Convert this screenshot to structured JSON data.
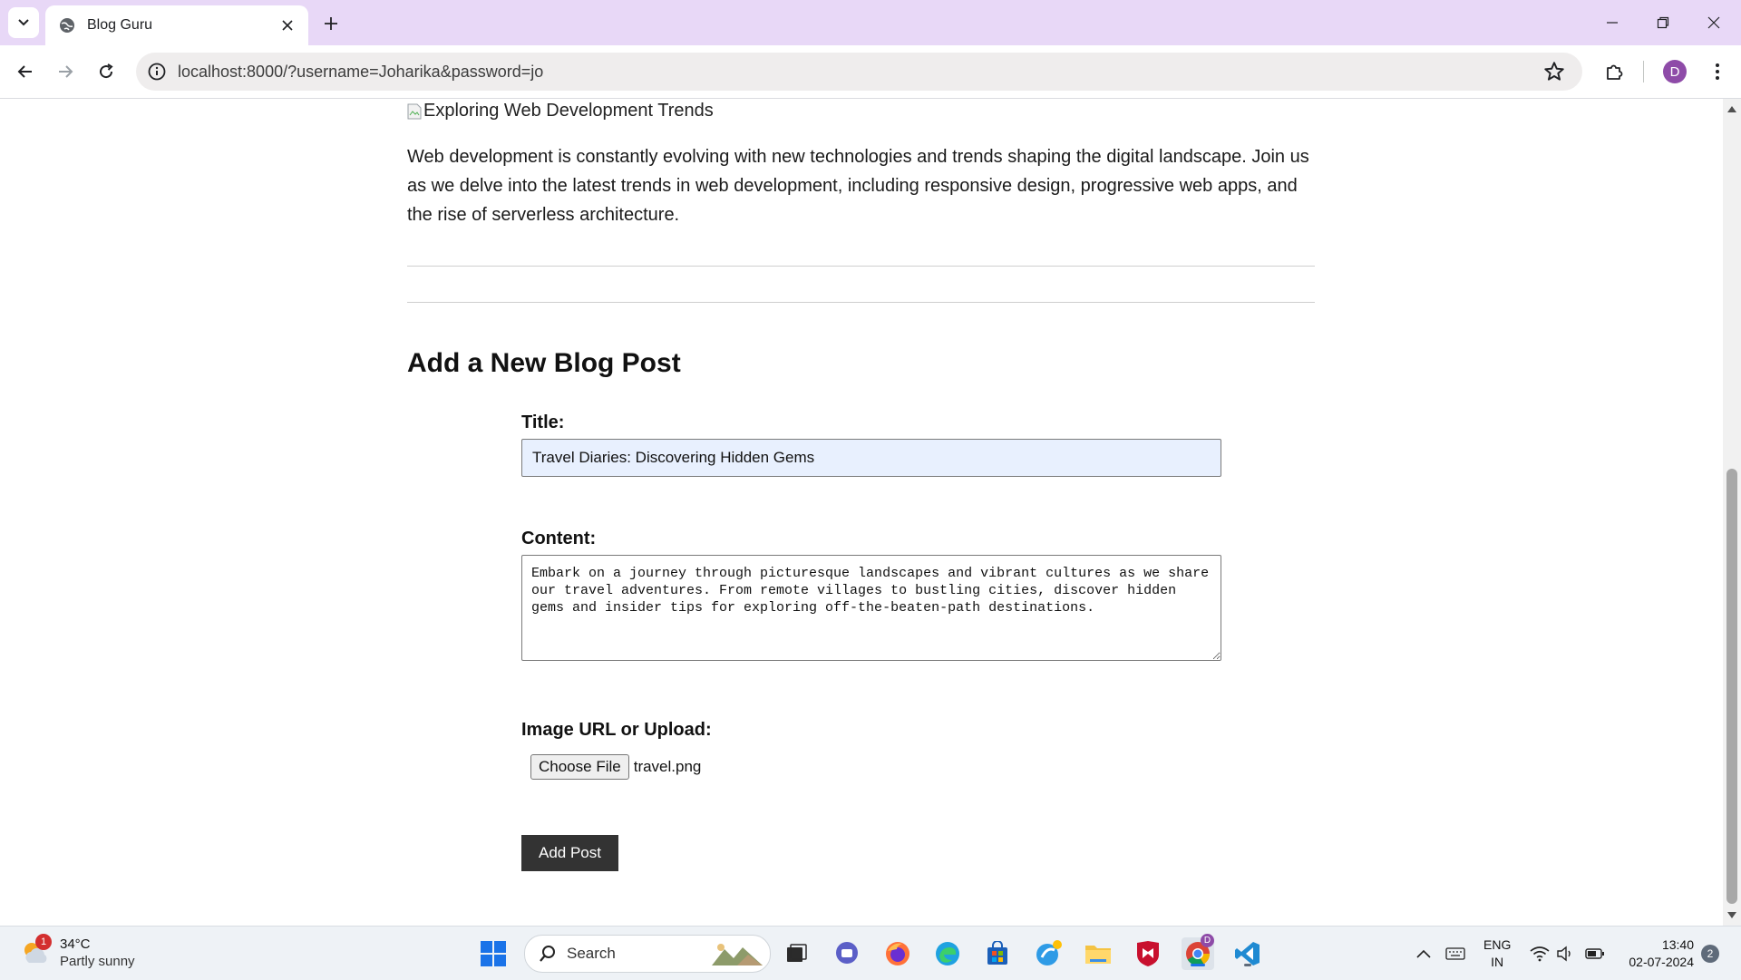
{
  "browser": {
    "tab_title": "Blog Guru",
    "url": "localhost:8000/?username=Joharika&password=jo",
    "profile_initial": "D"
  },
  "page": {
    "previous_post": {
      "image_alt": "Exploring Web Development Trends",
      "body": "Web development is constantly evolving with new technologies and trends shaping the digital landscape. Join us as we delve into the latest trends in web development, including responsive design, progressive web apps, and the rise of serverless architecture."
    },
    "form": {
      "heading": "Add a New Blog Post",
      "title_label": "Title:",
      "title_value": "Travel Diaries: Discovering Hidden Gems",
      "content_label": "Content:",
      "content_value": "Embark on a journey through picturesque landscapes and vibrant cultures as we share our travel adventures. From remote villages to bustling cities, discover hidden gems and insider tips for exploring off-the-beaten-path destinations.",
      "image_label": "Image URL or Upload:",
      "choose_file_label": "Choose File",
      "file_name": "travel.png",
      "submit_label": "Add Post"
    }
  },
  "taskbar": {
    "weather_temp": "34°C",
    "weather_condition": "Partly sunny",
    "weather_badge": "1",
    "search_label": "Search",
    "language_line1": "ENG",
    "language_line2": "IN",
    "time": "13:40",
    "date": "02-07-2024",
    "notification_count": "2",
    "chrome_badge": "D"
  },
  "colors": {
    "tabbar_bg": "#e8d8f7",
    "submit_bg": "#333333",
    "autofill_bg": "#e8f0fe"
  }
}
